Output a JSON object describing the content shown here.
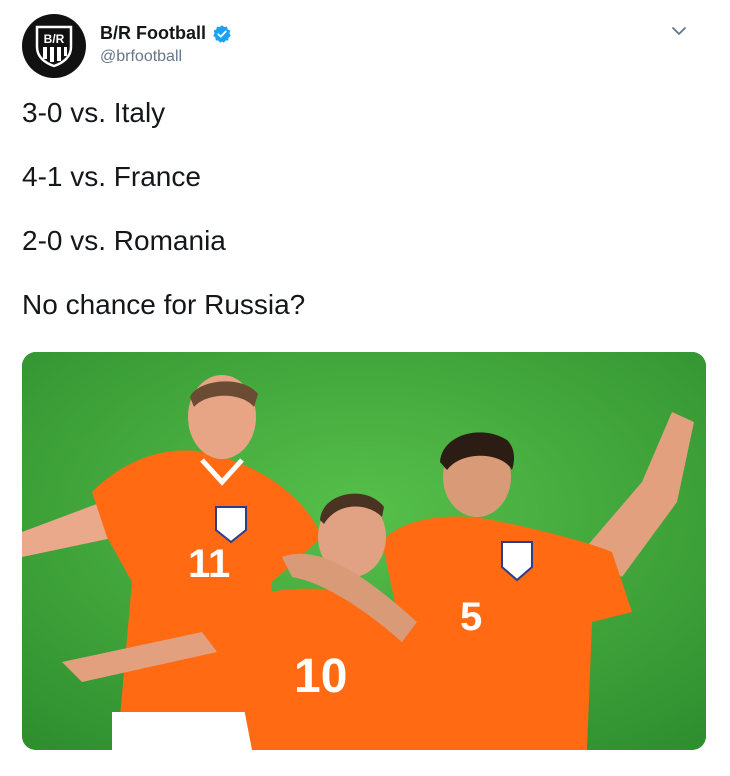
{
  "account": {
    "display_name": "B/R Football",
    "handle": "@brfootball",
    "verified": true,
    "avatar_icon": "br-logo-icon",
    "verified_icon": "verified-badge-icon",
    "menu_icon": "chevron-down-icon"
  },
  "tweet": {
    "lines": [
      "3-0 vs. Italy",
      "4-1 vs. France",
      "2-0 vs. Romania",
      "No chance for Russia?"
    ]
  },
  "media": {
    "jersey_numbers": [
      "11",
      "10",
      "5"
    ]
  },
  "colors": {
    "verified_blue": "#1da1f2",
    "avatar_bg": "#111111",
    "jersey_orange": "#ff6a13",
    "pitch_green": "#3ea53e"
  }
}
